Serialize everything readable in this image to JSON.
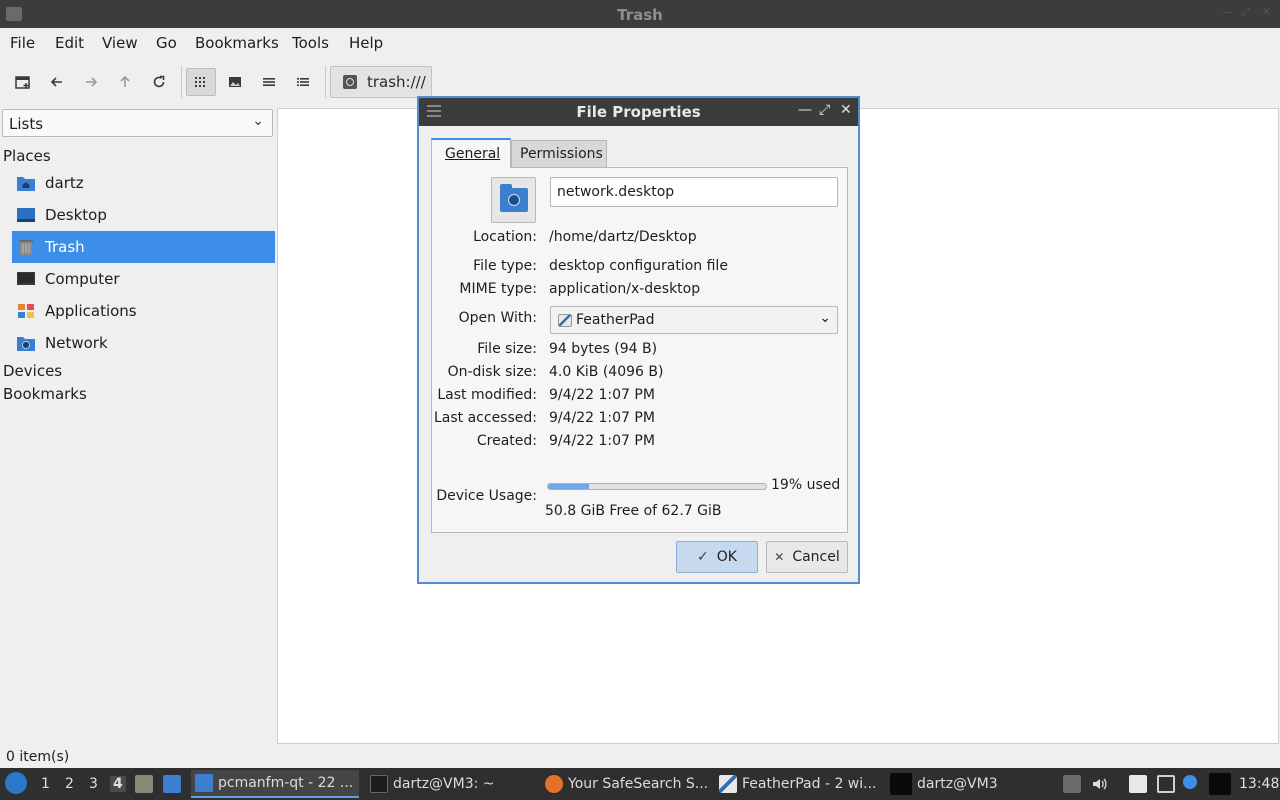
{
  "window": {
    "title": "Trash"
  },
  "menubar": {
    "items": [
      "File",
      "Edit",
      "View",
      "Go",
      "Bookmarks",
      "Tools",
      "Help"
    ]
  },
  "toolbar": {
    "path": "trash:///",
    "buttons": [
      "new-tab",
      "back",
      "forward",
      "up",
      "reload",
      "icon-view",
      "thumbnail-view",
      "compact-view",
      "detailed-list-view"
    ],
    "active_view": "icon-view"
  },
  "sidebar": {
    "mode": "Lists",
    "sections": {
      "places": "Places",
      "devices": "Devices",
      "bookmarks": "Bookmarks"
    },
    "places": [
      {
        "label": "dartz",
        "icon": "home-folder-icon",
        "selected": false
      },
      {
        "label": "Desktop",
        "icon": "desktop-icon",
        "selected": false
      },
      {
        "label": "Trash",
        "icon": "trash-icon",
        "selected": true
      },
      {
        "label": "Computer",
        "icon": "computer-icon",
        "selected": false
      },
      {
        "label": "Applications",
        "icon": "applications-icon",
        "selected": false
      },
      {
        "label": "Network",
        "icon": "network-folder-icon",
        "selected": false
      }
    ]
  },
  "status": {
    "text": "0 item(s)"
  },
  "dialog": {
    "title": "File Properties",
    "tabs": {
      "general": "General",
      "permissions": "Permissions"
    },
    "active_tab": "General",
    "filename": "network.desktop",
    "labels": {
      "location": "Location:",
      "file_type": "File type:",
      "mime_type": "MIME type:",
      "open_with": "Open With:",
      "file_size": "File size:",
      "on_disk_size": "On-disk size:",
      "last_modified": "Last modified:",
      "last_accessed": "Last accessed:",
      "created": "Created:",
      "device_usage": "Device Usage:"
    },
    "values": {
      "location": "/home/dartz/Desktop",
      "file_type": "desktop configuration file",
      "mime_type": "application/x-desktop",
      "open_with": "FeatherPad",
      "file_size": "94 bytes (94 B)",
      "on_disk_size": "4.0 KiB (4096 B)",
      "last_modified": "9/4/22 1:07 PM",
      "last_accessed": "9/4/22 1:07 PM",
      "created": "9/4/22 1:07 PM"
    },
    "usage": {
      "percent": 19,
      "percent_text": "19% used",
      "free_text": "50.8 GiB Free of 62.7 GiB"
    },
    "buttons": {
      "ok": "OK",
      "cancel": "Cancel"
    }
  },
  "taskbar": {
    "workspaces": [
      "1",
      "2",
      "3",
      "4"
    ],
    "current_workspace": "4",
    "tasks": [
      {
        "label": "pcmanfm-qt - 22 ...",
        "icon": "folder-icon",
        "active": true
      },
      {
        "label": "dartz@VM3: ~",
        "icon": "terminal-icon",
        "active": false
      },
      {
        "label": "Your SafeSearch S...",
        "icon": "firefox-icon",
        "active": false
      },
      {
        "label": "FeatherPad - 2 wi...",
        "icon": "featherpad-icon",
        "active": false
      },
      {
        "label": "dartz@VM3",
        "icon": "terminal-icon",
        "active": false
      }
    ],
    "clock": "13:48"
  },
  "colors": {
    "accent": "#3c8ee8",
    "titlebar": "#3c3c3c",
    "taskbar": "#2f2f2f"
  }
}
